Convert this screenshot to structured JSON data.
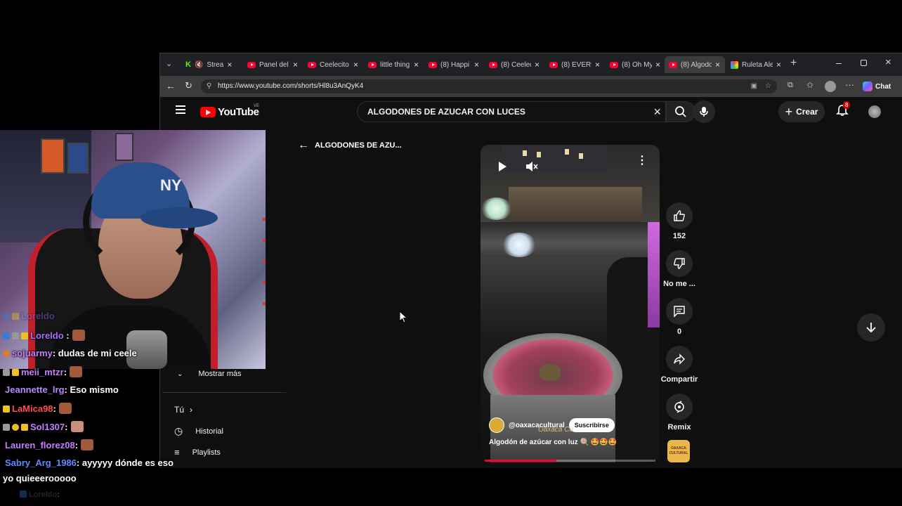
{
  "browser": {
    "tabs": [
      {
        "label": "Strea",
        "active": false
      },
      {
        "label": "Panel del",
        "active": false
      },
      {
        "label": "Ceelecito",
        "active": false
      },
      {
        "label": "little thing",
        "active": false
      },
      {
        "label": "(8) Happi",
        "active": false
      },
      {
        "label": "(8) Ceelec",
        "active": false
      },
      {
        "label": "(8) EVERG",
        "active": false
      },
      {
        "label": "(8) Oh My",
        "active": false
      },
      {
        "label": "(8) Algodo",
        "active": true
      },
      {
        "label": "Ruleta Ale",
        "active": false
      }
    ],
    "url": "https://www.youtube.com/shorts/Hl8u3AnQyK4",
    "chat_label": "Chat"
  },
  "youtube": {
    "logo_text": "YouTube",
    "logo_badge": "VE",
    "search_value": "ALGODONES DE AZUCAR CON LUCES",
    "create_label": "Crear",
    "notification_count": "8",
    "back_title": "ALGODONES DE AZU...",
    "sidebar": {
      "show_more": "Mostrar más",
      "you": "Tú",
      "history": "Historial",
      "playlists": "Playlists"
    },
    "short": {
      "channel": "@oaxacacultural",
      "subscribe": "Suscribirse",
      "caption": "Algodón de azúcar  con luz 🍭 🤩🤩🤩",
      "watermark": "Oaxaca Cu",
      "progress": 0.42
    },
    "actions": {
      "likes": "152",
      "dislike": "No me ...",
      "comments": "0",
      "share": "Compartir",
      "remix": "Remix"
    },
    "channel_thumb_text": "OAXACA CULTURAL"
  },
  "chat": {
    "messages": [
      {
        "user": "Loreldo",
        "text": "",
        "color": "#a970ff"
      },
      {
        "user": "sojuarmy",
        "text": ": dudas de mi ceele",
        "color": "#c77dff"
      },
      {
        "user": "meii_mtzr",
        "text": ":",
        "color": "#c77dff"
      },
      {
        "user": "Jeannette_lrg",
        "text": ": Eso mismo",
        "color": "#b78bff"
      },
      {
        "user": "LaMica98",
        "text": ":",
        "color": "#ff4d4d"
      },
      {
        "user": "Sol1307",
        "text": ":",
        "color": "#c77dff"
      },
      {
        "user": "Lauren_florez08",
        "text": ":",
        "color": "#c77dff"
      },
      {
        "user": "Sabry_Arg_1986",
        "text": ": ayyyyy dónde es eso",
        "color": "#5b8cff"
      },
      {
        "user": "",
        "text": "yo quieeerooooo",
        "color": "#ffffff"
      },
      {
        "user": "Loreldo",
        "text": ":",
        "color": "#6a5c99"
      }
    ]
  }
}
